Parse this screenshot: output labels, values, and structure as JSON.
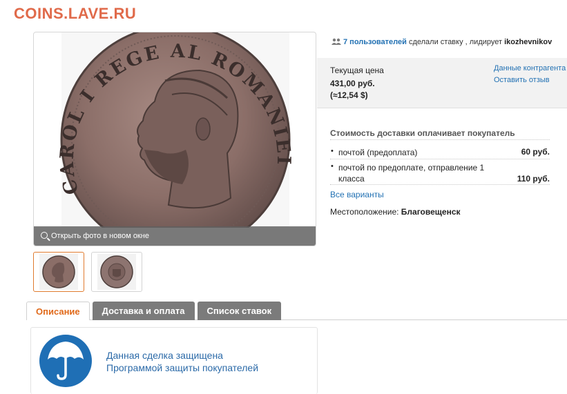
{
  "site": {
    "logo": "COINS.LAVE.RU"
  },
  "photo": {
    "open_label": "Открыть фото в новом окне",
    "legend_text": "CAROL I REGE AL ROMANIEI"
  },
  "bids": {
    "users_link": "7 пользователей",
    "text": " сделали ставку , лидирует ",
    "leader": "ikozhevnikov"
  },
  "price": {
    "label": "Текущая цена",
    "value": "431,00 руб.",
    "usd": "(≈12,54 $)",
    "counterparty_link": "Данные контрагента",
    "review_link": "Оставить отзыв"
  },
  "shipping": {
    "title": "Стоимость доставки оплачивает покупатель",
    "options": [
      {
        "name": "почтой (предоплата)",
        "cost": "60 руб."
      },
      {
        "name": "почтой по предоплате, отправление 1 класса",
        "cost": "110 руб."
      }
    ],
    "all_variants": "Все варианты",
    "location_label": "Местоположение: ",
    "location_value": "Благовещенск"
  },
  "tabs": [
    {
      "label": "Описание",
      "active": true
    },
    {
      "label": "Доставка и оплата",
      "active": false
    },
    {
      "label": "Список ставок",
      "active": false
    }
  ],
  "protection": {
    "line1": "Данная сделка защищена",
    "line2": "Программой защиты покупателей"
  },
  "colors": {
    "logo": "#e06a4a",
    "link": "#2271b3",
    "active_tab": "#e0691a",
    "protect_icon": "#1f6fb5"
  }
}
